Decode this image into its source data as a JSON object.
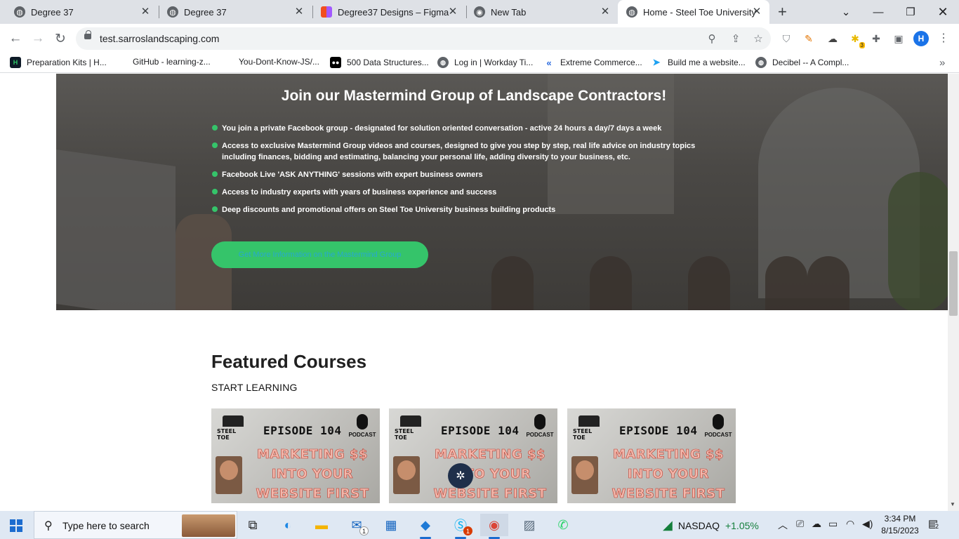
{
  "browser": {
    "tabs": [
      {
        "title": "Degree 37",
        "favicon": "globe-icon"
      },
      {
        "title": "Degree 37",
        "favicon": "globe-icon"
      },
      {
        "title": "Degree37 Designs – Figma",
        "favicon": "figma-icon"
      },
      {
        "title": "New Tab",
        "favicon": "chrome-icon"
      },
      {
        "title": "Home - Steel Toe University",
        "favicon": "globe-icon",
        "active": true
      }
    ],
    "url": "test.sarroslandscaping.com",
    "profile_initial": "H",
    "extension_badge": "3",
    "bookmarks": [
      {
        "label": "Preparation Kits | H...",
        "icon": "hackerrank-icon"
      },
      {
        "label": "GitHub - learning-z...",
        "icon": "github-icon"
      },
      {
        "label": "You-Dont-Know-JS/...",
        "icon": "github-icon"
      },
      {
        "label": "500 Data Structures...",
        "icon": "medium-icon"
      },
      {
        "label": "Log in | Workday Ti...",
        "icon": "globe-icon"
      },
      {
        "label": "Extreme Commerce...",
        "icon": "ec-icon"
      },
      {
        "label": "Build me a website...",
        "icon": "fiverr-icon"
      },
      {
        "label": "Decibel -- A Compl...",
        "icon": "globe-icon"
      }
    ]
  },
  "page": {
    "hero": {
      "title": "Join our Mastermind Group of Landscape Contractors!",
      "bullets": [
        "You join a private Facebook group - designated for solution oriented conversation - active 24 hours a day/7 days a week",
        "Access to exclusive Mastermind Group videos and courses, designed to give you step by step, real life advice on industry topics including finances, bidding and estimating, balancing your personal life, adding diversity to your business, etc.",
        "Facebook Live 'ASK ANYTHING' sessions with expert business owners",
        "Access to industry experts with years of business experience and success",
        "Deep discounts and promotional offers on Steel Toe University business building products"
      ],
      "cta_label": "Get More Information on the Mastermind Group"
    },
    "featured": {
      "title": "Featured Courses",
      "subtitle": "START LEARNING",
      "cards": [
        {
          "episode": "EPISODE 104",
          "logo_text": "STEEL TOE",
          "podcast_label": "PODCAST",
          "headline": [
            "MARKETING $$",
            "INTO YOUR",
            "WEBSITE FIRST"
          ]
        },
        {
          "episode": "EPISODE 104",
          "logo_text": "STEEL TOE",
          "podcast_label": "PODCAST",
          "headline": [
            "MARKETING $$",
            "INTO YOUR",
            "WEBSITE FIRST"
          ]
        },
        {
          "episode": "EPISODE 104",
          "logo_text": "STEEL TOE",
          "podcast_label": "PODCAST",
          "headline": [
            "MARKETING $$",
            "INTO YOUR",
            "WEBSITE FIRST"
          ]
        }
      ]
    },
    "accent_color": "#35c46a"
  },
  "taskbar": {
    "search_placeholder": "Type here to search",
    "mail_badge": "1",
    "skype_badge": "1",
    "stock_name": "NASDAQ",
    "stock_change": "+1.05%",
    "time": "3:34 PM",
    "date": "8/15/2023",
    "notifications": "2"
  }
}
